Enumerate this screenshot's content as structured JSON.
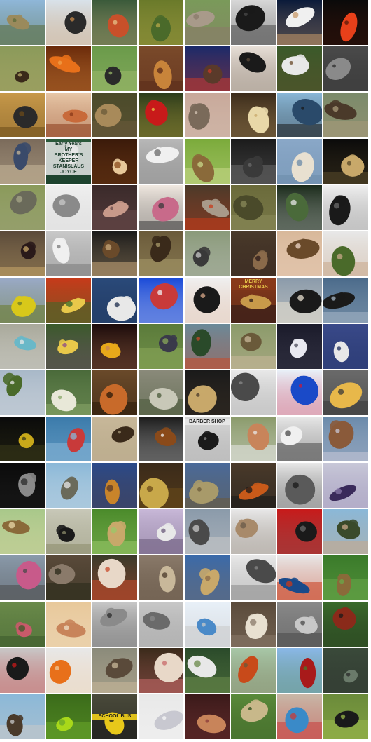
{
  "grid": {
    "columns": 8,
    "rows": 16,
    "tiles": [
      {
        "subject": "desert-landscape",
        "colors": [
          "#8fb7d9",
          "#9a8a5c",
          "#5a6b3a"
        ]
      },
      {
        "subject": "shorebird",
        "colors": [
          "#d8e2ea",
          "#2a2a2a",
          "#c88a4a"
        ]
      },
      {
        "subject": "crab",
        "colors": [
          "#3a5a3a",
          "#c8502a",
          "#e6c28a"
        ]
      },
      {
        "subject": "frog",
        "colors": [
          "#6a7a2a",
          "#4a6a2a",
          "#b8a84a"
        ]
      },
      {
        "subject": "stone-pillar",
        "colors": [
          "#7a9a5a",
          "#a89a8a",
          "#8a7a6a"
        ]
      },
      {
        "subject": "leather-bag",
        "colors": [
          "#d8d8d8",
          "#1a1a1a",
          "#4a4a4a"
        ]
      },
      {
        "subject": "plate-food",
        "colors": [
          "#0a1a3a",
          "#f0f0f0",
          "#c89a6a"
        ]
      },
      {
        "subject": "volcano-lava",
        "colors": [
          "#0a0a0a",
          "#e8401a",
          "#5a1a0a"
        ]
      },
      {
        "subject": "bison",
        "colors": [
          "#8a9a5a",
          "#3a2a1a",
          "#b8a86a"
        ]
      },
      {
        "subject": "goldfish",
        "colors": [
          "#6a2a0a",
          "#e8701a",
          "#f0a04a"
        ]
      },
      {
        "subject": "rifle",
        "colors": [
          "#6a9a4a",
          "#2a2a2a",
          "#9ab86a"
        ]
      },
      {
        "subject": "puppy-on-rug",
        "colors": [
          "#7a4a2a",
          "#c8843a",
          "#5a2a1a"
        ]
      },
      {
        "subject": "dog-on-couch",
        "colors": [
          "#1a2a6a",
          "#5a3a2a",
          "#c83a2a"
        ]
      },
      {
        "subject": "black-dog",
        "colors": [
          "#e8e0d8",
          "#1a1a1a",
          "#5a4a3a"
        ]
      },
      {
        "subject": "outdoor-table",
        "colors": [
          "#3a5a2a",
          "#e8e8e8",
          "#6a4a2a"
        ]
      },
      {
        "subject": "furry-animal",
        "colors": [
          "#4a4a4a",
          "#8a8a8a",
          "#2a2a2a"
        ]
      },
      {
        "subject": "wallet",
        "colors": [
          "#c89a4a",
          "#2a2a2a",
          "#6a4a1a"
        ]
      },
      {
        "subject": "crustacean",
        "colors": [
          "#e8c8a8",
          "#c86a3a",
          "#8a3a1a"
        ]
      },
      {
        "subject": "wild-dogs",
        "colors": [
          "#4a4a2a",
          "#a88a5a",
          "#6a5a3a"
        ]
      },
      {
        "subject": "christmas-stocking",
        "colors": [
          "#2a3a1a",
          "#c81a1a",
          "#e8c84a"
        ]
      },
      {
        "subject": "hay-field",
        "colors": [
          "#c8a89a",
          "#7a6a5a",
          "#d8c8b8"
        ]
      },
      {
        "subject": "pizza-dough",
        "colors": [
          "#3a2a1a",
          "#e8d8a8",
          "#c8a86a"
        ]
      },
      {
        "subject": "bridge",
        "colors": [
          "#8ab8d8",
          "#2a4a6a",
          "#1a1a1a"
        ]
      },
      {
        "subject": "dog-on-leash",
        "colors": [
          "#7a8a6a",
          "#4a3a2a",
          "#a89a7a"
        ]
      },
      {
        "subject": "shelf-ornament",
        "colors": [
          "#7a6a5a",
          "#3a4a6a",
          "#c8b89a"
        ]
      },
      {
        "subject": "book-cover",
        "colors": [
          "#2a5a3a",
          "#e8e8e8",
          "#1a3a2a"
        ]
      },
      {
        "subject": "wedding-hall",
        "colors": [
          "#3a1a0a",
          "#e8c89a",
          "#8a4a1a"
        ]
      },
      {
        "subject": "toilet",
        "colors": [
          "#b8b8b8",
          "#f0f0f0",
          "#6a6a6a"
        ]
      },
      {
        "subject": "monkey",
        "colors": [
          "#7aaa3a",
          "#8a6a3a",
          "#c8d88a"
        ]
      },
      {
        "subject": "phone-booth",
        "colors": [
          "#1a1a1a",
          "#3a3a3a",
          "#6a6a6a"
        ]
      },
      {
        "subject": "polar-bear",
        "colors": [
          "#8aa8c8",
          "#e8e0d0",
          "#6a8aa8"
        ]
      },
      {
        "subject": "ornate-chair",
        "colors": [
          "#0a0a0a",
          "#c8a86a",
          "#5a4a2a"
        ]
      },
      {
        "subject": "elephant",
        "colors": [
          "#8a9a5a",
          "#6a6a5a",
          "#a8a88a"
        ]
      },
      {
        "subject": "shopping-cart",
        "colors": [
          "#f0f0f0",
          "#8a8a8a",
          "#c8c8c8"
        ]
      },
      {
        "subject": "people-portrait",
        "colors": [
          "#3a2a2a",
          "#c89a8a",
          "#6a4a4a"
        ]
      },
      {
        "subject": "belt-rolls",
        "colors": [
          "#f0e8e0",
          "#c86a8a",
          "#3a3a3a"
        ]
      },
      {
        "subject": "gong",
        "colors": [
          "#4a3a2a",
          "#a89a8a",
          "#c83a1a"
        ]
      },
      {
        "subject": "starfish",
        "colors": [
          "#6a6a3a",
          "#4a4a2a",
          "#8a8a5a"
        ]
      },
      {
        "subject": "soccer-players",
        "colors": [
          "#1a2a1a",
          "#4a6a3a",
          "#e8e8e8"
        ]
      },
      {
        "subject": "spatula",
        "colors": [
          "#f0f0f0",
          "#1a1a1a",
          "#6a6a6a"
        ]
      },
      {
        "subject": "snake",
        "colors": [
          "#5a4a3a",
          "#2a1a1a",
          "#c8a86a"
        ]
      },
      {
        "subject": "window-gate",
        "colors": [
          "#c8c8c8",
          "#f0f0f0",
          "#7a7a7a"
        ]
      },
      {
        "subject": "rottweiler-puppy",
        "colors": [
          "#1a1a1a",
          "#6a4a2a",
          "#c8a87a"
        ]
      },
      {
        "subject": "elephants-trees",
        "colors": [
          "#6a5a3a",
          "#3a2a1a",
          "#a89a6a"
        ]
      },
      {
        "subject": "schnauzer",
        "colors": [
          "#8a9a7a",
          "#3a3a3a",
          "#c8c8c8"
        ]
      },
      {
        "subject": "hyena",
        "colors": [
          "#4a3a2a",
          "#8a6a4a",
          "#2a1a1a"
        ]
      },
      {
        "subject": "hair-grooming",
        "colors": [
          "#d8b89a",
          "#6a4a2a",
          "#f0d8c8"
        ]
      },
      {
        "subject": "man-eating",
        "colors": [
          "#e8e8e8",
          "#4a6a2a",
          "#c8a88a"
        ]
      },
      {
        "subject": "yellow-field",
        "colors": [
          "#9aaac8",
          "#d8c81a",
          "#6a7a2a"
        ]
      },
      {
        "subject": "seed-packets",
        "colors": [
          "#c83a1a",
          "#e8c84a",
          "#3a6a2a"
        ]
      },
      {
        "subject": "swan",
        "colors": [
          "#2a4a7a",
          "#e8e8e8",
          "#1a2a4a"
        ]
      },
      {
        "subject": "lighthouse",
        "colors": [
          "#1a4ad8",
          "#c83a3a",
          "#f0f0f0"
        ]
      },
      {
        "subject": "woman-sunglasses",
        "colors": [
          "#f0f0f0",
          "#1a1a1a",
          "#d8a88a"
        ]
      },
      {
        "subject": "pan-flute",
        "colors": [
          "#8a3a1a",
          "#c89a4a",
          "#2a1a1a"
        ]
      },
      {
        "subject": "chickadee",
        "colors": [
          "#8a9aaa",
          "#1a1a1a",
          "#e8e0d0"
        ]
      },
      {
        "subject": "dog-in-snow",
        "colors": [
          "#4a6a8a",
          "#1a1a1a",
          "#a8b8c8"
        ]
      },
      {
        "subject": "geyser-pool",
        "colors": [
          "#a8a89a",
          "#6ab8c8",
          "#e8e8e8"
        ]
      },
      {
        "subject": "butterfly-flowers",
        "colors": [
          "#3a5a2a",
          "#e8c84a",
          "#8a4a8a"
        ]
      },
      {
        "subject": "hand-match",
        "colors": [
          "#1a0a0a",
          "#e8a81a",
          "#c8845a"
        ]
      },
      {
        "subject": "soldiers",
        "colors": [
          "#5a7a3a",
          "#3a3a4a",
          "#8aa85a"
        ]
      },
      {
        "subject": "lake-cafe",
        "colors": [
          "#6a8a9a",
          "#2a4a2a",
          "#c84a2a"
        ]
      },
      {
        "subject": "quail",
        "colors": [
          "#8a9a6a",
          "#6a5a3a",
          "#c8b89a"
        ]
      },
      {
        "subject": "dark-room",
        "colors": [
          "#1a1a2a",
          "#e8e8f0",
          "#4a4a5a"
        ]
      },
      {
        "subject": "lamp",
        "colors": [
          "#3a4a8a",
          "#e8e8e8",
          "#1a2a5a"
        ]
      },
      {
        "subject": "farm-road",
        "colors": [
          "#a8b8c8",
          "#4a6a2a",
          "#e8e8e8"
        ]
      },
      {
        "subject": "cauliflower",
        "colors": [
          "#4a6a3a",
          "#e8e8d8",
          "#8aa86a"
        ]
      },
      {
        "subject": "fox",
        "colors": [
          "#6a4a2a",
          "#c86a2a",
          "#2a1a0a"
        ]
      },
      {
        "subject": "chain-fence",
        "colors": [
          "#8a8a7a",
          "#c8c8b8",
          "#4a5a3a"
        ]
      },
      {
        "subject": "hand-dark",
        "colors": [
          "#1a1a1a",
          "#c8a86a",
          "#4a3a2a"
        ]
      },
      {
        "subject": "tank",
        "colors": [
          "#e8e8e8",
          "#4a4a4a",
          "#8a8a8a"
        ]
      },
      {
        "subject": "knot-rope",
        "colors": [
          "#e8f0f8",
          "#1a4ac8",
          "#c81a3a"
        ]
      },
      {
        "subject": "soup-pot",
        "colors": [
          "#6a6a6a",
          "#e8b84a",
          "#3a3a3a"
        ]
      },
      {
        "subject": "prayer-rug",
        "colors": [
          "#0a0a0a",
          "#c8a81a",
          "#3a3a1a"
        ]
      },
      {
        "subject": "swimmers",
        "colors": [
          "#3a7aaa",
          "#c83a3a",
          "#8ab8d8"
        ]
      },
      {
        "subject": "hawk-field",
        "colors": [
          "#c8b89a",
          "#3a2a1a",
          "#a89a7a"
        ]
      },
      {
        "subject": "baseball-glove",
        "colors": [
          "#1a1a1a",
          "#8a4a1a",
          "#f0f0f0"
        ]
      },
      {
        "subject": "barber-shop",
        "colors": [
          "#d8d8d8",
          "#1a1a1a",
          "#8a8a8a"
        ]
      },
      {
        "subject": "pit-bull",
        "colors": [
          "#8a9a6a",
          "#c8845a",
          "#e8e8e8"
        ]
      },
      {
        "subject": "white-van",
        "colors": [
          "#e8e8e8",
          "#f0f0f0",
          "#4a4a4a"
        ]
      },
      {
        "subject": "squirrel",
        "colors": [
          "#6a8aaa",
          "#8a5a3a",
          "#c8c8d8"
        ]
      },
      {
        "subject": "snail-shadow",
        "colors": [
          "#0a0a0a",
          "#8a8a8a",
          "#2a2a2a"
        ]
      },
      {
        "subject": "lighthouse-shore",
        "colors": [
          "#8ab8d8",
          "#6a6a5a",
          "#e8e8e8"
        ]
      },
      {
        "subject": "sunset-cliff",
        "colors": [
          "#2a4a8a",
          "#c8842a",
          "#5a3a2a"
        ]
      },
      {
        "subject": "trumpet",
        "colors": [
          "#3a2a1a",
          "#c8a84a",
          "#6a4a1a"
        ]
      },
      {
        "subject": "grass-plant",
        "colors": [
          "#4a6a9a",
          "#a89a6a",
          "#6a5a3a"
        ]
      },
      {
        "subject": "red-fox",
        "colors": [
          "#4a3a2a",
          "#c85a1a",
          "#1a1a1a"
        ]
      },
      {
        "subject": "bird-perched",
        "colors": [
          "#e8e8e8",
          "#5a5a5a",
          "#1a1a1a"
        ]
      },
      {
        "subject": "keyboard",
        "colors": [
          "#c8c8d8",
          "#3a2a5a",
          "#8a7aaa"
        ]
      },
      {
        "subject": "sparrow",
        "colors": [
          "#a8c88a",
          "#8a6a3a",
          "#e8d8a8"
        ]
      },
      {
        "subject": "beetle",
        "colors": [
          "#c8c8b8",
          "#1a1a1a",
          "#8a8a6a"
        ]
      },
      {
        "subject": "snail",
        "colors": [
          "#4a8a2a",
          "#c8a86a",
          "#9ac86a"
        ]
      },
      {
        "subject": "lighthouse-cliff",
        "colors": [
          "#c8b8d8",
          "#e8e8e8",
          "#6a5a7a"
        ]
      },
      {
        "subject": "seals",
        "colors": [
          "#8a9aaa",
          "#4a4a4a",
          "#c8c8c8"
        ]
      },
      {
        "subject": "rope-knot",
        "colors": [
          "#e8e8e8",
          "#a88a6a",
          "#6a5a4a"
        ]
      },
      {
        "subject": "camera",
        "colors": [
          "#c81a1a",
          "#1a1a1a",
          "#6a6a6a"
        ]
      },
      {
        "subject": "people-bench",
        "colors": [
          "#8ab8d8",
          "#3a4a2a",
          "#c8a88a"
        ]
      },
      {
        "subject": "street-scene",
        "colors": [
          "#8a9aaa",
          "#c85a8a",
          "#4a4a4a"
        ]
      },
      {
        "subject": "turtle",
        "colors": [
          "#5a4a3a",
          "#8a7a6a",
          "#2a2a1a"
        ]
      },
      {
        "subject": "vintage-car",
        "colors": [
          "#3a3a2a",
          "#e8d8c8",
          "#c84a2a"
        ]
      },
      {
        "subject": "meerkat",
        "colors": [
          "#8a7a6a",
          "#c8b89a",
          "#4a3a2a"
        ]
      },
      {
        "subject": "ruins",
        "colors": [
          "#3a6aaa",
          "#c8a86a",
          "#8a6a4a"
        ]
      },
      {
        "subject": "poncho",
        "colors": [
          "#e8e8e8",
          "#4a4a4a",
          "#8a8a8a"
        ]
      },
      {
        "subject": "beaded-ornament",
        "colors": [
          "#e8e8e8",
          "#1a4a8a",
          "#c83a1a"
        ]
      },
      {
        "subject": "grasshopper",
        "colors": [
          "#3a7a2a",
          "#8a6a3a",
          "#6aa84a"
        ]
      },
      {
        "subject": "grass-reeds",
        "colors": [
          "#6a8a4a",
          "#c85a6a",
          "#3a5a2a"
        ]
      },
      {
        "subject": "seashell",
        "colors": [
          "#e8c89a",
          "#c8845a",
          "#f0e0c8"
        ]
      },
      {
        "subject": "ducks-water",
        "colors": [
          "#c8c8c8",
          "#8a8a8a",
          "#2a2a2a"
        ]
      },
      {
        "subject": "cat",
        "colors": [
          "#c8c8c8",
          "#6a6a6a",
          "#8a8a8a"
        ]
      },
      {
        "subject": "webpage",
        "colors": [
          "#e8f0f8",
          "#4a8ac8",
          "#c8c8c8"
        ]
      },
      {
        "subject": "jug",
        "colors": [
          "#5a4a3a",
          "#e8e0d0",
          "#8a7a6a"
        ]
      },
      {
        "subject": "road-stones",
        "colors": [
          "#8a8a8a",
          "#c8c8c8",
          "#4a4a4a"
        ]
      },
      {
        "subject": "rooster",
        "colors": [
          "#3a6a2a",
          "#8a2a1a",
          "#1a1a1a"
        ]
      },
      {
        "subject": "cola-bottles",
        "colors": [
          "#c8c8c8",
          "#1a1a1a",
          "#c81a1a"
        ]
      },
      {
        "subject": "orange-fish",
        "colors": [
          "#e8e8e8",
          "#e8701a",
          "#f0c89a"
        ]
      },
      {
        "subject": "dog-face",
        "colors": [
          "#8a8a7a",
          "#5a4a3a",
          "#c8b89a"
        ]
      },
      {
        "subject": "pig-figurines",
        "colors": [
          "#3a2a1a",
          "#e8d8c8",
          "#c86a6a"
        ]
      },
      {
        "subject": "plant-bowl",
        "colors": [
          "#2a4a2a",
          "#e8e8e8",
          "#6a8a4a"
        ]
      },
      {
        "subject": "robin",
        "colors": [
          "#a8c8a8",
          "#c84a1a",
          "#6a5a3a"
        ]
      },
      {
        "subject": "red-barn",
        "colors": [
          "#8ab8e8",
          "#a81a1a",
          "#4a7a2a"
        ]
      },
      {
        "subject": "crocodile",
        "colors": [
          "#3a4a3a",
          "#6a7a6a",
          "#2a2a2a"
        ]
      },
      {
        "subject": "tall-ship",
        "colors": [
          "#8ab8d8",
          "#4a3a2a",
          "#c8c8c8"
        ]
      },
      {
        "subject": "green-apples",
        "colors": [
          "#3a6a1a",
          "#a8d81a",
          "#6aa82a"
        ]
      },
      {
        "subject": "school-bus",
        "colors": [
          "#4a4a3a",
          "#e8c81a",
          "#1a1a1a"
        ]
      },
      {
        "subject": "white-fur",
        "colors": [
          "#e8e8e8",
          "#c8c8d0",
          "#f8f8f8"
        ]
      },
      {
        "subject": "figs",
        "colors": [
          "#3a1a1a",
          "#c8845a",
          "#8a3a3a"
        ]
      },
      {
        "subject": "palm-street",
        "colors": [
          "#5a8a3a",
          "#c8b88a",
          "#2a4a1a"
        ]
      },
      {
        "subject": "toy-balls",
        "colors": [
          "#c8b8a8",
          "#3a8ac8",
          "#c83a3a"
        ]
      },
      {
        "subject": "black-puppies",
        "colors": [
          "#6a8a3a",
          "#1a1a1a",
          "#9ab84a"
        ]
      }
    ]
  },
  "text": {
    "book_line1": "Early Years",
    "book_line2": "MY",
    "book_line3": "BROTHER'S",
    "book_line4": "KEEPER",
    "book_line5": "STANISLAUS",
    "book_line6": "JOYCE",
    "shop_sign": "BARBER SHOP",
    "bus_sign": "SCHOOL BUS",
    "xmas_banner": "MERRY CHRISTMAS"
  }
}
